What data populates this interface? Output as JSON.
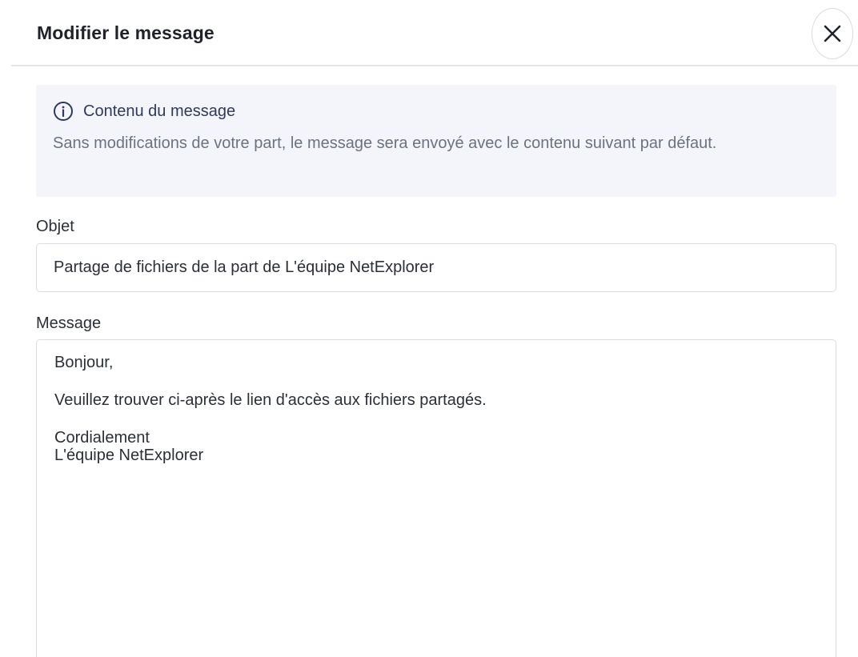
{
  "dialog": {
    "title": "Modifier le message",
    "close_icon": "close-icon"
  },
  "info": {
    "icon": "info-icon",
    "title": "Contenu du message",
    "text": "Sans modifications de votre part, le message sera envoyé avec le contenu suivant par défaut."
  },
  "subject": {
    "label": "Objet",
    "value": "Partage de fichiers de la part de L'équipe NetExplorer"
  },
  "message": {
    "label": "Message",
    "greeting": "Bonjour,",
    "body": "Veuillez trouver ci-après le lien d'accès aux fichiers partagés.",
    "closing": "Cordialement",
    "signature": "L'équipe NetExplorer"
  },
  "colors": {
    "info_background": "#f3f5fa",
    "info_title": "#2e3a5c",
    "muted_text": "#6b7280",
    "border": "#d9dce1"
  }
}
